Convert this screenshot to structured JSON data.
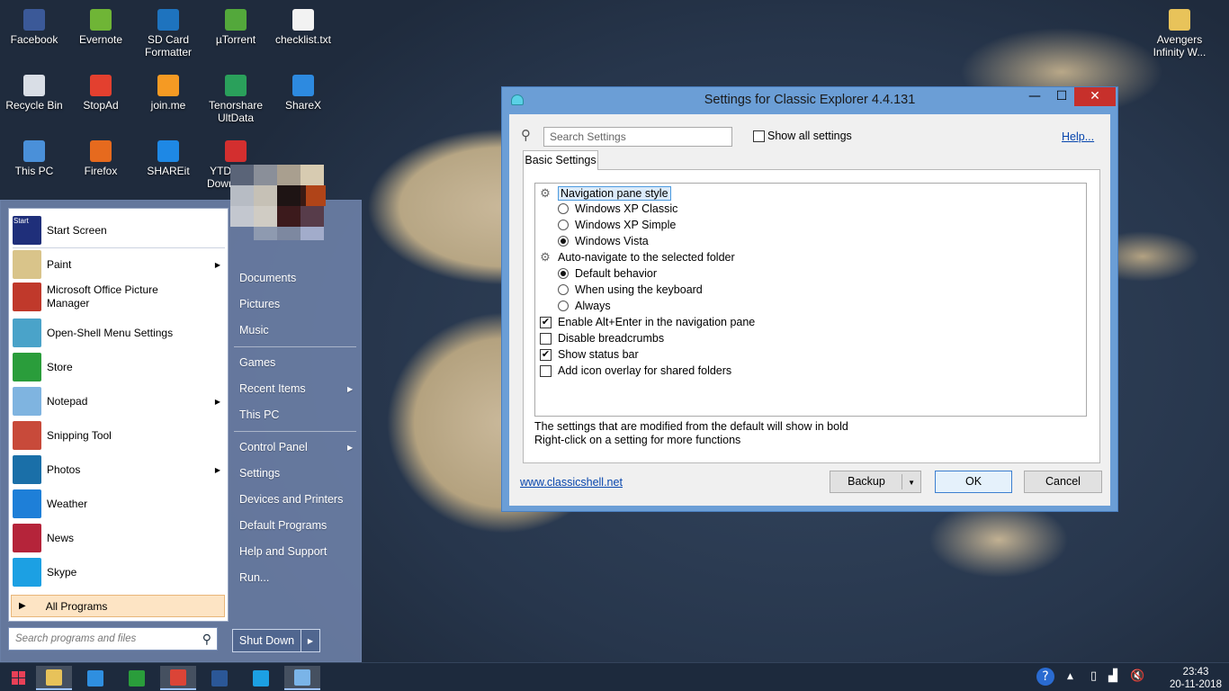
{
  "desktop": {
    "icons": [
      {
        "label": "Facebook",
        "color": "#3b5998"
      },
      {
        "label": "Evernote",
        "color": "#6fb536"
      },
      {
        "label": "SD Card Formatter",
        "color": "#1e73be"
      },
      {
        "label": "µTorrent",
        "color": "#53a83b"
      },
      {
        "label": "checklist.txt",
        "color": "#f2f2f2"
      },
      {
        "label": "Recycle Bin",
        "color": "#d9dee6"
      },
      {
        "label": "StopAd",
        "color": "#e3402f"
      },
      {
        "label": "join.me",
        "color": "#f59a23"
      },
      {
        "label": "Tenorshare UltData",
        "color": "#2aa05b"
      },
      {
        "label": "ShareX",
        "color": "#2d8ae0"
      },
      {
        "label": "This PC",
        "color": "#4a90d9"
      },
      {
        "label": "Firefox",
        "color": "#e66a1e"
      },
      {
        "label": "SHAREit",
        "color": "#1e88e5"
      },
      {
        "label": "YTD Video Downloader",
        "color": "#d32f2f"
      },
      {
        "label": "Avengers Infinity W...",
        "color": "#e8c35a"
      }
    ]
  },
  "start_menu": {
    "pinned": [
      {
        "label": "Start Screen",
        "icon": "start-screen-icon",
        "color": "#1f2f7a",
        "arrow": ""
      },
      {
        "label": "Paint",
        "icon": "paint-icon",
        "color": "#d9c48a",
        "arrow": "▶"
      },
      {
        "label": "Microsoft Office Picture Manager",
        "icon": "picture-manager-icon",
        "color": "#c0392b",
        "arrow": ""
      },
      {
        "label": "Open-Shell Menu Settings",
        "icon": "open-shell-icon",
        "color": "#4aa3c9",
        "arrow": ""
      },
      {
        "label": "Store",
        "icon": "store-icon",
        "color": "#2a9d3b",
        "arrow": ""
      },
      {
        "label": "Notepad",
        "icon": "notepad-icon",
        "color": "#7fb4e0",
        "arrow": "▶"
      },
      {
        "label": "Snipping Tool",
        "icon": "scissors-icon",
        "color": "#c84a3a",
        "arrow": ""
      },
      {
        "label": "Photos",
        "icon": "photos-icon",
        "color": "#1a6fa8",
        "arrow": "▶"
      },
      {
        "label": "Weather",
        "icon": "weather-icon",
        "color": "#1e7fd8",
        "arrow": ""
      },
      {
        "label": "News",
        "icon": "news-icon",
        "color": "#b5243a",
        "arrow": ""
      },
      {
        "label": "Skype",
        "icon": "skype-icon",
        "color": "#1ca0e3",
        "arrow": ""
      }
    ],
    "all_programs": "All Programs",
    "search_placeholder": "Search programs and files",
    "right_items": [
      {
        "label": "Documents",
        "arrow": ""
      },
      {
        "label": "Pictures",
        "arrow": ""
      },
      {
        "label": "Music",
        "arrow": ""
      },
      {
        "label": "Games",
        "arrow": ""
      },
      {
        "label": "Recent Items",
        "arrow": "▶"
      },
      {
        "label": "This PC",
        "arrow": ""
      },
      {
        "label": "Control Panel",
        "arrow": "▶"
      },
      {
        "label": "Settings",
        "arrow": ""
      },
      {
        "label": "Devices and Printers",
        "arrow": ""
      },
      {
        "label": "Default Programs",
        "arrow": ""
      },
      {
        "label": "Help and Support",
        "arrow": ""
      },
      {
        "label": "Run...",
        "arrow": ""
      }
    ],
    "shutdown": "Shut Down",
    "shutdown_arrow": "▶",
    "start_screen_badge": "Start"
  },
  "dialog": {
    "title": "Settings for Classic Explorer 4.4.131",
    "minimize": "—",
    "maximize": "☐",
    "close": "✕",
    "search_placeholder": "Search Settings",
    "show_all": "Show all settings",
    "help": "Help...",
    "tab": "Basic Settings",
    "settings": [
      {
        "type": "group",
        "label": "Navigation pane style",
        "highlight": true
      },
      {
        "type": "radio",
        "label": "Windows XP Classic",
        "checked": false
      },
      {
        "type": "radio",
        "label": "Windows XP Simple",
        "checked": false
      },
      {
        "type": "radio",
        "label": "Windows Vista",
        "checked": true
      },
      {
        "type": "group",
        "label": "Auto-navigate to the selected folder",
        "highlight": false
      },
      {
        "type": "radio",
        "label": "Default behavior",
        "checked": true
      },
      {
        "type": "radio",
        "label": "When using the keyboard",
        "checked": false
      },
      {
        "type": "radio",
        "label": "Always",
        "checked": false
      },
      {
        "type": "check",
        "label": "Enable Alt+Enter in the navigation pane",
        "checked": true
      },
      {
        "type": "check",
        "label": "Disable breadcrumbs",
        "checked": false
      },
      {
        "type": "check",
        "label": "Show status bar",
        "checked": true
      },
      {
        "type": "check",
        "label": "Add icon overlay for shared folders",
        "checked": false
      }
    ],
    "note1": "The settings that are modified from the default will show in bold",
    "note2": "Right-click on a setting for more functions",
    "website": "www.classicshell.net",
    "backup": "Backup",
    "ok": "OK",
    "cancel": "Cancel"
  },
  "taskbar": {
    "apps": [
      {
        "name": "file-explorer-icon",
        "color": "#e7c25a",
        "active": true
      },
      {
        "name": "internet-explorer-icon",
        "color": "#2f8fe0",
        "active": false
      },
      {
        "name": "store-icon",
        "color": "#2a9d3b",
        "active": false
      },
      {
        "name": "chrome-icon",
        "color": "#db4437",
        "active": true
      },
      {
        "name": "word-icon",
        "color": "#2b5797",
        "active": false
      },
      {
        "name": "skype-icon",
        "color": "#1ca0e3",
        "active": false
      },
      {
        "name": "settings-window-icon",
        "color": "#7ab4e8",
        "active": true
      }
    ],
    "time": "23:43",
    "date": "20-11-2018"
  }
}
